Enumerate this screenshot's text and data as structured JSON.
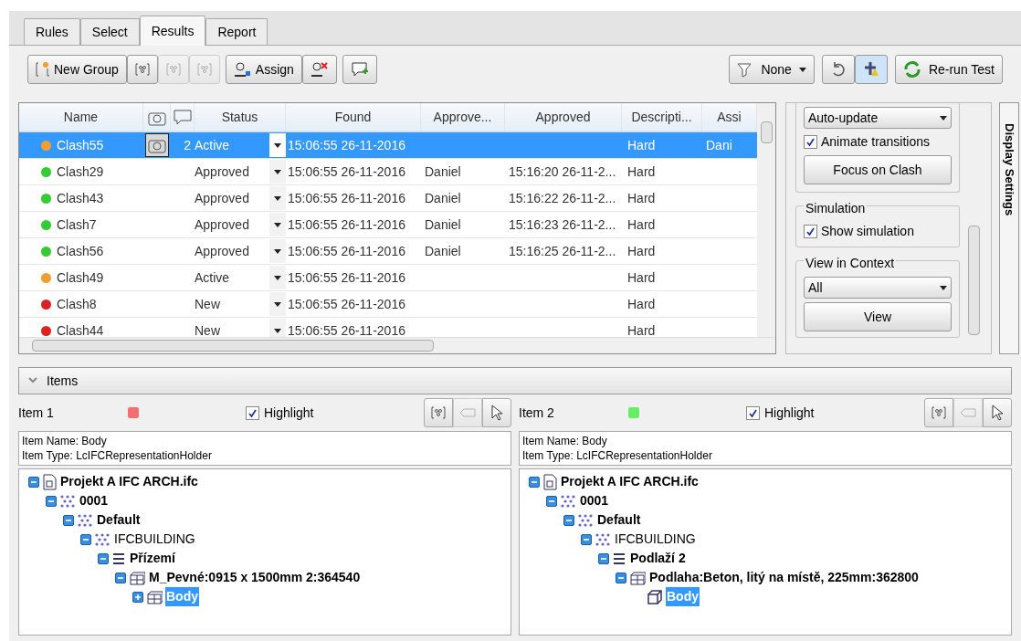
{
  "tabs": [
    {
      "label": "Rules",
      "selected": false
    },
    {
      "label": "Select",
      "selected": false
    },
    {
      "label": "Results",
      "selected": true
    },
    {
      "label": "Report",
      "selected": false
    }
  ],
  "toolbar": {
    "new_group": "New Group",
    "assign": "Assign",
    "filter": "None",
    "rerun": "Re-run Test"
  },
  "table": {
    "columns": [
      "Name",
      "Status",
      "Found",
      "Approve...",
      "Approved",
      "Descripti...",
      "Assi"
    ],
    "rows": [
      {
        "name": "Clash55",
        "color": "#f0a030",
        "camera": true,
        "comments": "2",
        "status": "Active",
        "found": "15:06:55 26-11-2016",
        "description": "Hard",
        "assigned": "Dani",
        "selected": true
      },
      {
        "name": "Clash29",
        "color": "#33cc33",
        "camera": false,
        "status": "Approved",
        "found": "15:06:55 26-11-2016",
        "approved_by": "Daniel",
        "approved": "15:16:20 26-11-2...",
        "description": "Hard",
        "selected": false
      },
      {
        "name": "Clash43",
        "color": "#33cc33",
        "camera": false,
        "status": "Approved",
        "found": "15:06:55 26-11-2016",
        "approved_by": "Daniel",
        "approved": "15:16:22 26-11-2...",
        "description": "Hard",
        "selected": false
      },
      {
        "name": "Clash7",
        "color": "#33cc33",
        "camera": false,
        "status": "Approved",
        "found": "15:06:55 26-11-2016",
        "approved_by": "Daniel",
        "approved": "15:16:23 26-11-2...",
        "description": "Hard",
        "selected": false
      },
      {
        "name": "Clash56",
        "color": "#33cc33",
        "camera": false,
        "status": "Approved",
        "found": "15:06:55 26-11-2016",
        "approved_by": "Daniel",
        "approved": "15:16:25 26-11-2...",
        "description": "Hard",
        "selected": false
      },
      {
        "name": "Clash49",
        "color": "#f0a030",
        "camera": false,
        "status": "Active",
        "found": "15:06:55 26-11-2016",
        "description": "Hard",
        "selected": false
      },
      {
        "name": "Clash8",
        "color": "#dd2222",
        "camera": false,
        "status": "New",
        "found": "15:06:55 26-11-2016",
        "description": "Hard",
        "selected": false
      },
      {
        "name": "Clash44",
        "color": "#dd2222",
        "camera": false,
        "status": "New",
        "found": "15:06:55 26-11-2016",
        "description": "Hard",
        "selected": false
      }
    ]
  },
  "display": {
    "viewpoint_mode": "Auto-update",
    "animate": {
      "label": "Animate transitions",
      "checked": true
    },
    "focus": "Focus on Clash",
    "simulation": {
      "title": "Simulation",
      "label": "Show simulation",
      "checked": true
    },
    "context": {
      "title": "View in Context",
      "value": "All",
      "button": "View"
    },
    "side_tab": "Display Settings"
  },
  "items_header": "Items",
  "items": [
    {
      "title": "Item 1",
      "color": "#f07070",
      "highlight": {
        "label": "Highlight",
        "checked": true
      },
      "info": [
        "Item Name: Body",
        "Item Type: LcIFCRepresentationHolder"
      ],
      "tree": [
        {
          "label": "Projekt A IFC ARCH.ifc",
          "kind": "file",
          "bold": true,
          "expanded": true,
          "children": [
            {
              "label": "0001",
              "kind": "layer",
              "bold": true,
              "expanded": true,
              "children": [
                {
                  "label": "Default",
                  "kind": "layer",
                  "bold": true,
                  "expanded": true,
                  "children": [
                    {
                      "label": "IFCBUILDING",
                      "kind": "layer",
                      "bold": false,
                      "expanded": true,
                      "children": [
                        {
                          "label": "Přízemí",
                          "kind": "level",
                          "bold": true,
                          "expanded": true,
                          "children": [
                            {
                              "label": "M_Pevné:0915 x 1500mm 2:364540",
                              "kind": "group",
                              "bold": true,
                              "expanded": true,
                              "children": [
                                {
                                  "label": "Body",
                                  "kind": "group",
                                  "bold": true,
                                  "expanded": false,
                                  "selected": true
                                }
                              ]
                            }
                          ]
                        }
                      ]
                    }
                  ]
                }
              ]
            }
          ]
        }
      ]
    },
    {
      "title": "Item 2",
      "color": "#66ee66",
      "highlight": {
        "label": "Highlight",
        "checked": true
      },
      "info": [
        "Item Name: Body",
        "Item Type: LcIFCRepresentationHolder"
      ],
      "tree": [
        {
          "label": "Projekt A IFC ARCH.ifc",
          "kind": "file",
          "bold": true,
          "expanded": true,
          "children": [
            {
              "label": "0001",
              "kind": "layer",
              "bold": true,
              "expanded": true,
              "children": [
                {
                  "label": "Default",
                  "kind": "layer",
                  "bold": true,
                  "expanded": true,
                  "children": [
                    {
                      "label": "IFCBUILDING",
                      "kind": "layer",
                      "bold": false,
                      "expanded": true,
                      "children": [
                        {
                          "label": "Podlaží 2",
                          "kind": "level",
                          "bold": true,
                          "expanded": true,
                          "children": [
                            {
                              "label": "Podlaha:Beton, litý na místě, 225mm:362800",
                              "kind": "group",
                              "bold": true,
                              "expanded": true,
                              "children": [
                                {
                                  "label": "Body",
                                  "kind": "box",
                                  "bold": true,
                                  "selected": true
                                }
                              ]
                            }
                          ]
                        }
                      ]
                    }
                  ]
                }
              ]
            }
          ]
        }
      ]
    }
  ]
}
